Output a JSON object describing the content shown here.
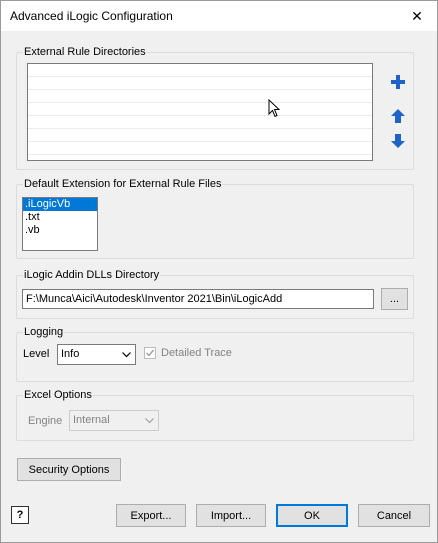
{
  "window": {
    "title": "Advanced iLogic Configuration",
    "close_glyph": "✕"
  },
  "external_rule_dirs": {
    "label": "External Rule Directories",
    "add_icon": "plus-icon",
    "up_icon": "arrow-up-icon",
    "down_icon": "arrow-down-icon"
  },
  "default_extension": {
    "label": "Default Extension for External Rule Files",
    "items": [
      ".iLogicVb",
      ".txt",
      ".vb"
    ],
    "selected_index": 0
  },
  "addin_dir": {
    "label": "iLogic Addin DLLs Directory",
    "path": "F:\\Munca\\Aici\\Autodesk\\Inventor 2021\\Bin\\iLogicAdd",
    "browse_label": "..."
  },
  "logging": {
    "label": "Logging",
    "level_label": "Level",
    "level_value": "Info",
    "detailed_trace_label": "Detailed Trace",
    "detailed_trace_checked": true
  },
  "excel": {
    "label": "Excel Options",
    "engine_label": "Engine",
    "engine_value": "Internal"
  },
  "buttons": {
    "security": "Security Options",
    "export": "Export...",
    "import": "Import...",
    "ok": "OK",
    "cancel": "Cancel",
    "help_glyph": "?"
  },
  "colors": {
    "accent": "#0078d7",
    "arrow_blue": "#1e64c8"
  }
}
